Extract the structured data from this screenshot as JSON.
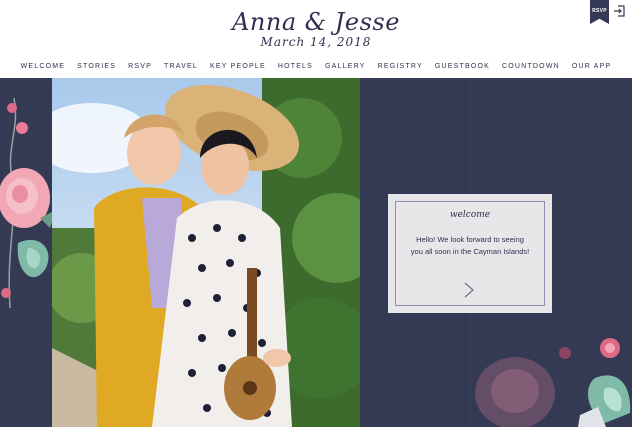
{
  "header": {
    "couple_name": "Anna & Jesse",
    "wedding_date": "March 14, 2018"
  },
  "nav": {
    "items": [
      {
        "label": "WELCOME"
      },
      {
        "label": "STORIES"
      },
      {
        "label": "RSVP"
      },
      {
        "label": "TRAVEL"
      },
      {
        "label": "KEY PEOPLE"
      },
      {
        "label": "HOTELS"
      },
      {
        "label": "GALLERY"
      },
      {
        "label": "REGISTRY"
      },
      {
        "label": "GUESTBOOK"
      },
      {
        "label": "COUNTDOWN"
      },
      {
        "label": "OUR APP"
      }
    ]
  },
  "rsvp_ribbon": {
    "label": "RSVP"
  },
  "welcome_card": {
    "title": "welcome",
    "message": "Hello! We look forward to seeing you all soon in the Cayman Islands!"
  },
  "colors": {
    "navy": "#343954",
    "text": "#2f3150",
    "card": "#e7e7ea"
  },
  "icons": {
    "login": "login-icon",
    "next": "chevron-right-icon"
  }
}
